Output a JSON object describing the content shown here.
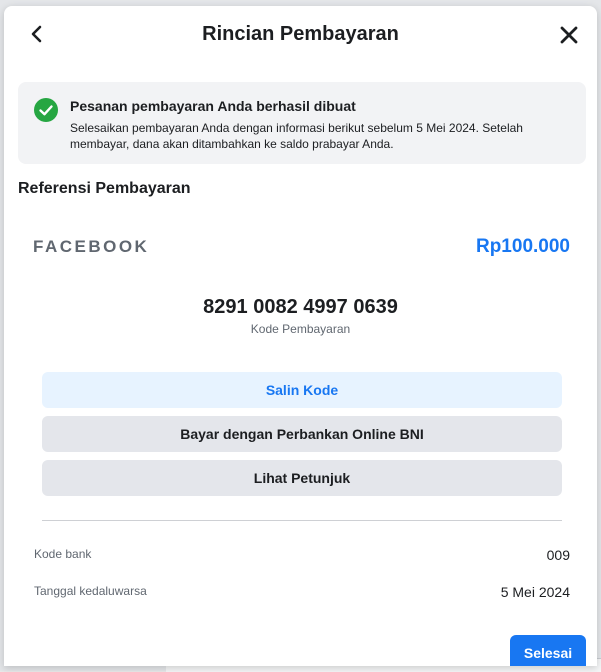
{
  "dialog": {
    "title": "Rincian Pembayaran"
  },
  "banner": {
    "title": "Pesanan pembayaran Anda berhasil dibuat",
    "text": "Selesaikan pembayaran Anda dengan informasi berikut sebelum 5 Mei 2024. Setelah membayar, dana akan ditambahkan ke saldo prabayar Anda."
  },
  "reference": {
    "section_title": "Referensi Pembayaran",
    "brand": "FACEBOOK",
    "amount": "Rp100.000",
    "code": "8291 0082 4997 0639",
    "code_label": "Kode Pembayaran"
  },
  "actions": {
    "copy": "Salin Kode",
    "bank": "Bayar dengan Perbankan Online BNI",
    "guide": "Lihat Petunjuk"
  },
  "details": [
    {
      "label": "Kode bank",
      "value": "009"
    },
    {
      "label": "Tanggal kedaluwarsa",
      "value": "5 Mei 2024"
    }
  ],
  "footer": {
    "done": "Selesai"
  },
  "colors": {
    "accent": "#1877f2",
    "success": "#26a642"
  },
  "icons": {
    "back": "chevron-left-icon",
    "close": "close-icon",
    "success": "check-circle-icon"
  }
}
